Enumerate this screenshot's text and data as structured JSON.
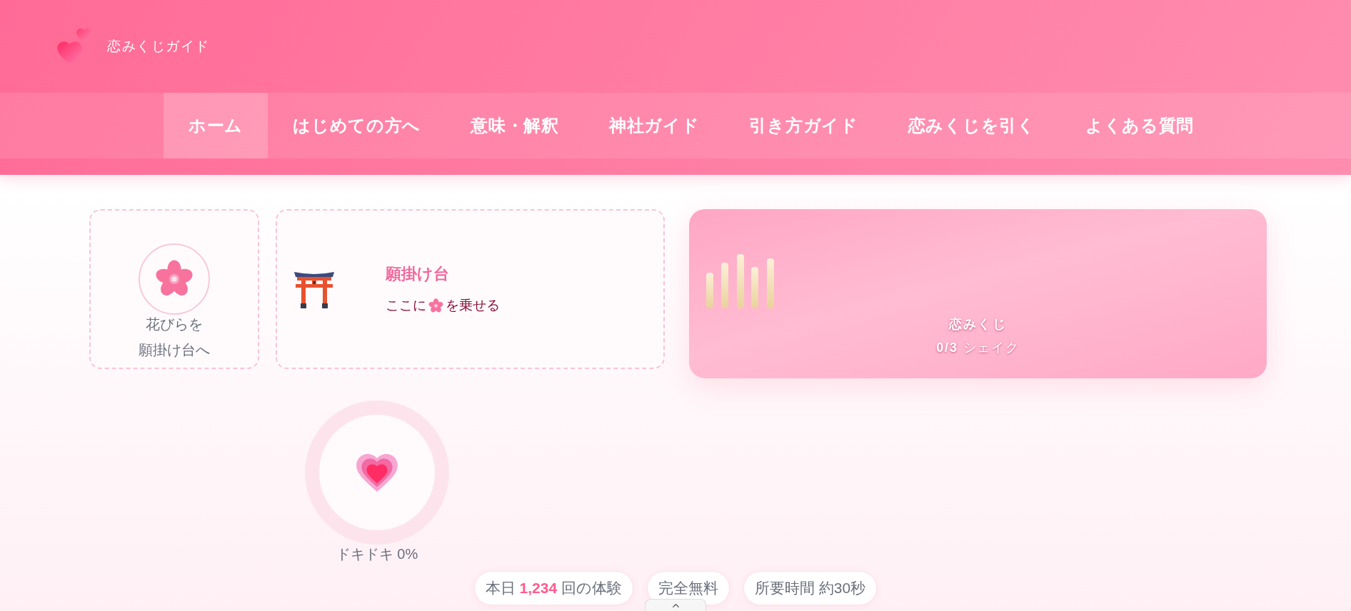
{
  "header": {
    "logo_text": "恋みくじガイド"
  },
  "nav": [
    {
      "label": "ホーム",
      "selected": true
    },
    {
      "label": "はじめての方へ",
      "selected": false
    },
    {
      "label": "意味・解釈",
      "selected": false
    },
    {
      "label": "神社ガイド",
      "selected": false
    },
    {
      "label": "引き方ガイド",
      "selected": false
    },
    {
      "label": "恋みくじを引く",
      "selected": false
    },
    {
      "label": "よくある質問",
      "selected": false
    }
  ],
  "petal_card": {
    "hint_lines": [
      "花びらを",
      "願掛け台へ"
    ]
  },
  "wish_stand": {
    "title": "願掛け台",
    "instruction_before": "ここに",
    "instruction_after": "を乗せる"
  },
  "omikuji_box": {
    "title": "恋みくじ",
    "shake_status": "**0/3** シェイク"
  },
  "heart_meter": {
    "label": "ドキドキ 0%"
  },
  "stats": [
    "本日 **1,234** 回の体験",
    "完全無料",
    "所要時間 約30秒"
  ]
}
